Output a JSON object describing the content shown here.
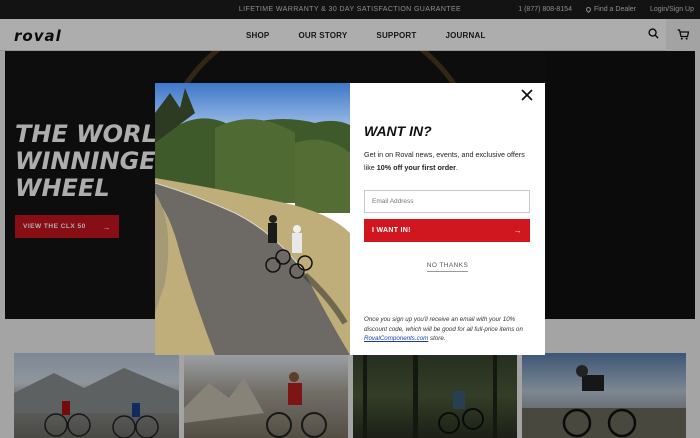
{
  "announcement": {
    "text": "LIFETIME WARRANTY & 30 DAY SATISFACTION GUARANTEE",
    "phone": "1 (877) 808-8154",
    "find_dealer": "Find a Dealer",
    "login": "Login/Sign Up"
  },
  "nav": {
    "logo": "roval",
    "items": [
      {
        "label": "SHOP"
      },
      {
        "label": "OUR STORY"
      },
      {
        "label": "SUPPORT"
      },
      {
        "label": "JOURNAL"
      }
    ]
  },
  "hero": {
    "title": "THE WORL\nWINNINGE\nWHEEL",
    "cta": "VIEW THE CLX 50"
  },
  "modal": {
    "title": "WANT IN?",
    "body_prefix": "Get in on Roval news, events, and exclusive offers like ",
    "body_bold": "10% off your first order",
    "body_suffix": ".",
    "email_placeholder": "Email Address",
    "submit": "I WANT IN!",
    "no_thanks": "NO THANKS",
    "fine_prefix": "Once you sign up you'll receive an email with your 10% discount code, which will be good for all full-price items on ",
    "fine_link": "RovalComponents.com",
    "fine_suffix": " store."
  },
  "colors": {
    "accent": "#d0161f",
    "announce_bg": "#1d1d1d"
  }
}
